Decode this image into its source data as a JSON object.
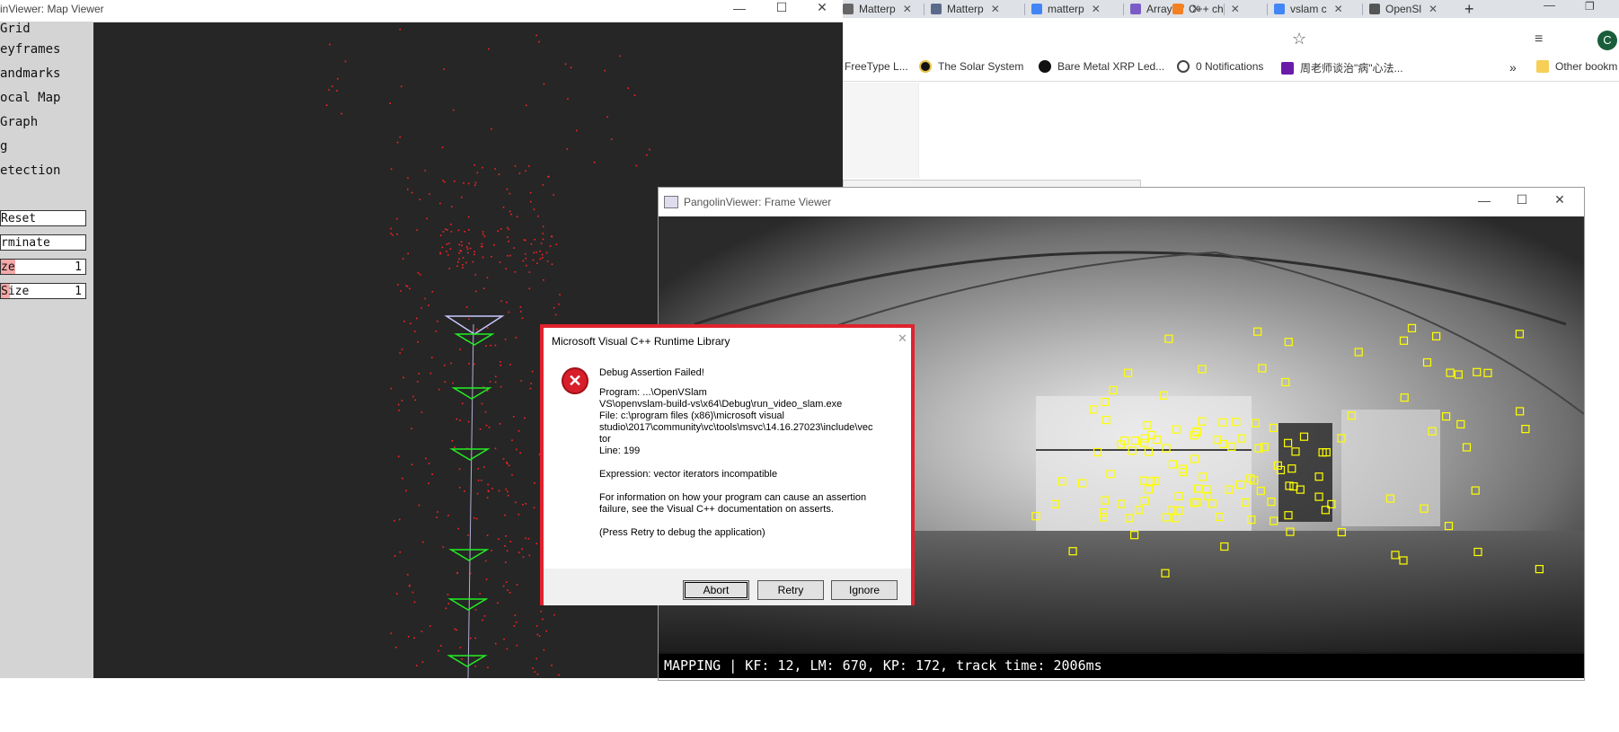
{
  "browser": {
    "tabs": [
      {
        "label": "Matterp",
        "color": "#666"
      },
      {
        "label": "Matterp",
        "color": "#5a6a8a"
      },
      {
        "label": "matterp",
        "color": "#4285f4"
      },
      {
        "label": "Array of",
        "color": "#7a5cc7"
      },
      {
        "label": "C++ ch",
        "color": "#f48024"
      },
      {
        "label": "vslam c",
        "color": "#4285f4"
      },
      {
        "label": "OpenSl",
        "color": "#555"
      }
    ],
    "new_tab": "+",
    "bookmarks": [
      {
        "label": "FreeType L...",
        "color": "#e8b34a"
      },
      {
        "label": "The Solar System",
        "color": "#222"
      },
      {
        "label": "Bare Metal XRP Led...",
        "color": "#222"
      },
      {
        "label": "0 Notifications",
        "color": "#444"
      },
      {
        "label": "周老师谈治\"病\"心法...",
        "color": "#6a1ca8"
      }
    ],
    "bookmarks_more": "»",
    "other_bookmarks": "Other bookm"
  },
  "map_viewer": {
    "title": "inViewer: Map Viewer",
    "menu": [
      "Grid",
      "eyframes",
      "andmarks",
      "ocal Map",
      "Graph",
      "g",
      "etection"
    ],
    "buttons": [
      "Reset",
      "rminate"
    ],
    "sliders": [
      {
        "label": "ze",
        "value": "1"
      },
      {
        "label": " Size",
        "value": "1"
      }
    ]
  },
  "frame_viewer": {
    "title": "PangolinViewer: Frame Viewer",
    "status": "MAPPING | KF: 12, LM: 670, KP: 172, track time: 2006ms"
  },
  "dialog": {
    "title": "Microsoft Visual C++ Runtime Library",
    "heading": "Debug Assertion Failed!",
    "program_line1": "Program: ...\\OpenVSlam",
    "program_line2": "VS\\openvslam-build-vs\\x64\\Debug\\run_video_slam.exe",
    "file_line1": "File: c:\\program files (x86)\\microsoft visual",
    "file_line2": "studio\\2017\\community\\vc\\tools\\msvc\\14.16.27023\\include\\vec",
    "file_line3": "tor",
    "line": "Line: 199",
    "expression": "Expression: vector iterators incompatible",
    "info_line1": "For information on how your program can cause an assertion",
    "info_line2": "failure, see the Visual C++ documentation on asserts.",
    "retry_hint": "(Press Retry to debug the application)",
    "abort": "Abort",
    "retry": "Retry",
    "ignore": "Ignore"
  },
  "colors": {
    "dialog_border": "#e0232e",
    "keyframe": "#22ee22",
    "current_frame": "#c8c8ff",
    "landmark": "#ff2222",
    "feature_box": "#ffff00"
  }
}
